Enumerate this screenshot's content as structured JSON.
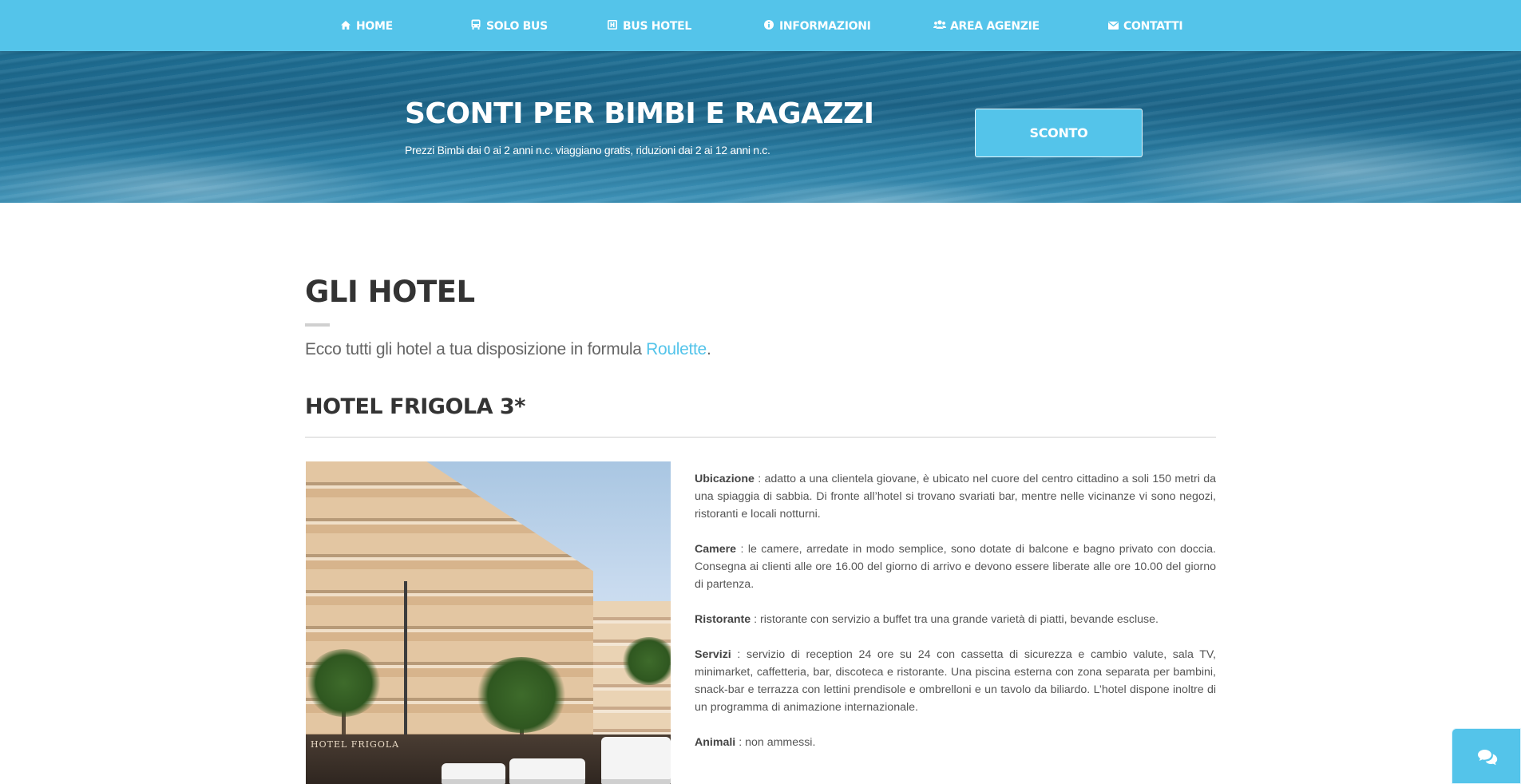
{
  "nav": {
    "items": [
      {
        "label": "HOME",
        "icon": "home-icon"
      },
      {
        "label": "SOLO BUS",
        "icon": "bus-icon"
      },
      {
        "label": "BUS HOTEL",
        "icon": "hotel-icon"
      },
      {
        "label": "INFORMAZIONI",
        "icon": "info-icon"
      },
      {
        "label": "AREA AGENZIE",
        "icon": "users-icon"
      },
      {
        "label": "CONTATTI",
        "icon": "envelope-icon"
      }
    ]
  },
  "hero": {
    "title": "SCONTI PER BIMBI E RAGAZZI",
    "subtitle": "Prezzi Bimbi dai 0 ai 2 anni n.c. viaggiano gratis, riduzioni dai 2 ai 12 anni n.c.",
    "button_label": "SCONTO"
  },
  "main": {
    "title": "GLI HOTEL",
    "intro_text": "Ecco tutti gli hotel a tua disposizione in formula ",
    "intro_link": "Roulette",
    "intro_end": "."
  },
  "hotel": {
    "name": "HOTEL FRIGOLA 3*",
    "photo_sign": "HOTEL FRIGOLA",
    "details": [
      {
        "label": "Ubicazione",
        "text": " : adatto a una clientela giovane, è ubicato nel cuore del centro cittadino a soli 150 metri da una spiaggia di sabbia. Di fronte all’hotel si trovano svariati bar, mentre nelle vicinanze vi sono negozi, ristoranti e locali notturni."
      },
      {
        "label": "Camere",
        "text": " : le camere, arredate in modo semplice, sono dotate di balcone e bagno privato con doccia. Consegna ai clienti alle ore 16.00 del giorno di arrivo e devono essere liberate alle ore 10.00 del giorno di partenza."
      },
      {
        "label": "Ristorante",
        "text": " : ristorante con servizio a buffet tra una grande varietà di piatti, bevande escluse."
      },
      {
        "label": "Servizi",
        "text": " : servizio di reception 24 ore su 24 con cassetta di sicurezza e cambio valute, sala TV, minimarket, caffetteria, bar, discoteca e ristorante. Una piscina esterna con zona separata per bambini, snack-bar e terrazza con lettini prendisole e ombrelloni e un tavolo da biliardo. L’hotel dispone inoltre di un programma di animazione internazionale."
      },
      {
        "label": "Animali",
        "text": " : non ammessi."
      }
    ]
  },
  "colors": {
    "accent": "#54c4ea",
    "heading": "#333333",
    "text": "#555555"
  }
}
